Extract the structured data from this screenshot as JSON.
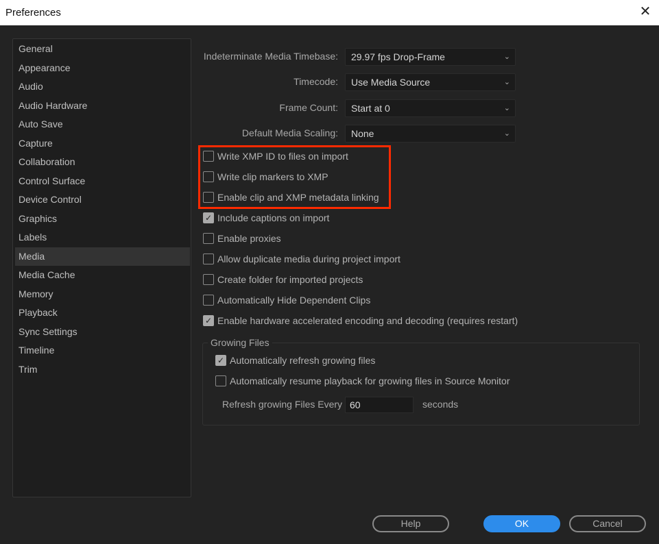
{
  "window": {
    "title": "Preferences"
  },
  "sidebar": {
    "items": [
      "General",
      "Appearance",
      "Audio",
      "Audio Hardware",
      "Auto Save",
      "Capture",
      "Collaboration",
      "Control Surface",
      "Device Control",
      "Graphics",
      "Labels",
      "Media",
      "Media Cache",
      "Memory",
      "Playback",
      "Sync Settings",
      "Timeline",
      "Trim"
    ],
    "selected": "Media"
  },
  "fields": [
    {
      "label": "Indeterminate Media Timebase:",
      "value": "29.97 fps Drop-Frame"
    },
    {
      "label": "Timecode:",
      "value": "Use Media Source"
    },
    {
      "label": "Frame Count:",
      "value": "Start at 0"
    },
    {
      "label": "Default Media Scaling:",
      "value": "None"
    }
  ],
  "checkboxes": [
    {
      "label": "Write XMP ID to files on import",
      "checked": false
    },
    {
      "label": "Write clip markers to XMP",
      "checked": false
    },
    {
      "label": "Enable clip and XMP metadata linking",
      "checked": false
    },
    {
      "label": "Include captions on import",
      "checked": true
    },
    {
      "label": "Enable proxies",
      "checked": false
    },
    {
      "label": "Allow duplicate media during project import",
      "checked": false
    },
    {
      "label": "Create folder for imported projects",
      "checked": false
    },
    {
      "label": "Automatically Hide Dependent Clips",
      "checked": false
    },
    {
      "label": "Enable hardware accelerated encoding and decoding (requires restart)",
      "checked": true
    }
  ],
  "growing": {
    "title": "Growing Files",
    "checkboxes": [
      {
        "label": "Automatically refresh growing files",
        "checked": true
      },
      {
        "label": "Automatically resume playback for growing files in Source Monitor",
        "checked": false
      }
    ],
    "refresh_label": "Refresh growing Files Every",
    "refresh_value": "60",
    "unit": "seconds"
  },
  "buttons": {
    "help": "Help",
    "ok": "OK",
    "cancel": "Cancel"
  },
  "colors": {
    "highlight": "#ff2a00",
    "accent": "#2d8ceb"
  }
}
